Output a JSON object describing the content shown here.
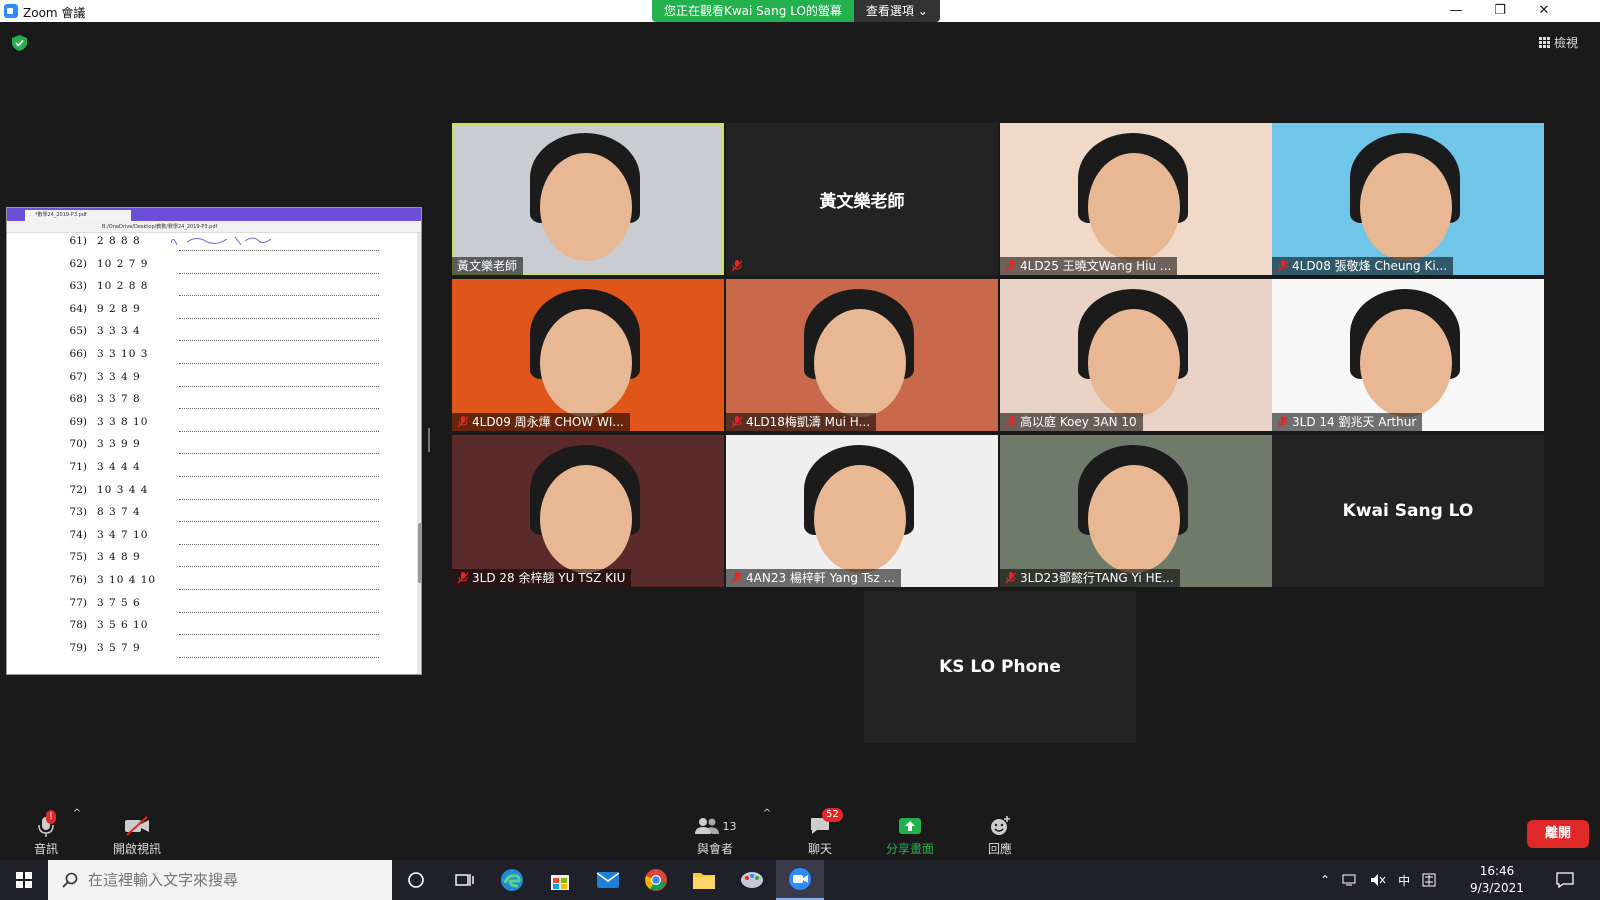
{
  "window": {
    "title": "Zoom 會議",
    "minimize": "—",
    "restore": "❐",
    "close": "✕"
  },
  "banner": {
    "viewing": "您正在觀看Kwai Sang LO的螢幕",
    "options": "查看選項 ⌄"
  },
  "view_button": "檢視",
  "pdf": {
    "tab": "*數學24_2019-P3.pdf",
    "address": "B:/OneDrive/Desktop/教數/數學24_2019-P3.pdf",
    "rows": [
      {
        "num": "61)",
        "val": "2 8 8 8"
      },
      {
        "num": "62)",
        "val": "10 2 7 9"
      },
      {
        "num": "63)",
        "val": "10 2 8 8"
      },
      {
        "num": "64)",
        "val": "9 2 8 9"
      },
      {
        "num": "65)",
        "val": "3 3 3 4"
      },
      {
        "num": "66)",
        "val": "3 3 10 3"
      },
      {
        "num": "67)",
        "val": "3 3 4 9"
      },
      {
        "num": "68)",
        "val": "3 3 7 8"
      },
      {
        "num": "69)",
        "val": "3 3 8 10"
      },
      {
        "num": "70)",
        "val": "3 3 9 9"
      },
      {
        "num": "71)",
        "val": "3 4 4 4"
      },
      {
        "num": "72)",
        "val": "10 3 4 4"
      },
      {
        "num": "73)",
        "val": "8 3 7 4"
      },
      {
        "num": "74)",
        "val": "3 4 7 10"
      },
      {
        "num": "75)",
        "val": "3 4 8 9"
      },
      {
        "num": "76)",
        "val": "3 10 4 10"
      },
      {
        "num": "77)",
        "val": "3 7 5 6"
      },
      {
        "num": "78)",
        "val": "3 5 6 10"
      },
      {
        "num": "79)",
        "val": "3 5 7 9"
      }
    ]
  },
  "participants": [
    {
      "name": "黃文樂老師",
      "video": true,
      "muted": false,
      "active": true,
      "bg": "#c9cdd2"
    },
    {
      "name": "黃文樂老師",
      "video": false,
      "muted": true,
      "center": "黃文樂老師"
    },
    {
      "name": "4LD25 王曉文Wang Hiu ...",
      "video": true,
      "muted": true,
      "bg": "#f0d9c9"
    },
    {
      "name": "4LD08 張敬烽 Cheung Ki...",
      "video": true,
      "muted": true,
      "bg": "#6fc6e8"
    },
    {
      "name": "4LD09 周永燁 CHOW WI...",
      "video": true,
      "muted": true,
      "bg": "#e0561a"
    },
    {
      "name": "4LD18梅凱濤 Mui       H...",
      "video": true,
      "muted": true,
      "bg": "#c7694a"
    },
    {
      "name": "高以庭 Koey 3AN 10",
      "video": true,
      "muted": true,
      "bg": "#e9d3c6"
    },
    {
      "name": "3LD 14 劉兆天 Arthur",
      "video": true,
      "muted": true,
      "bg": "#f7f7f7"
    },
    {
      "name": "3LD 28 余梓翹 YU TSZ KIU",
      "video": true,
      "muted": true,
      "bg": "#5b2a2a"
    },
    {
      "name": "4AN23 楊梓軒 Yang Tsz ...",
      "video": true,
      "muted": true,
      "bg": "#efefef"
    },
    {
      "name": "3LD23鄧懿行TANG Yi HE...",
      "video": true,
      "muted": true,
      "bg": "#6e7a6a"
    },
    {
      "name": "Kwai Sang LO",
      "video": false,
      "muted": false,
      "center": "Kwai Sang LO"
    },
    {
      "name": "KS LO Phone",
      "video": false,
      "muted": false,
      "center": "KS LO Phone"
    }
  ],
  "toolbar": {
    "audio": "音訊",
    "audio_alert": "!",
    "video": "開啟視訊",
    "participants": "與會者",
    "participants_count": "13",
    "chat": "聊天",
    "chat_count": "52",
    "share": "分享畫面",
    "reactions": "回應",
    "leave": "離開",
    "caret": "^"
  },
  "taskbar": {
    "search_placeholder": "在這裡輸入文字來搜尋",
    "ime": "中",
    "time": "16:46",
    "date": "9/3/2021"
  },
  "colors": {
    "accent": "#2d8cff",
    "share_green": "#23b14d",
    "active_speaker": "#c6e44b",
    "leave_red": "#e02828"
  }
}
